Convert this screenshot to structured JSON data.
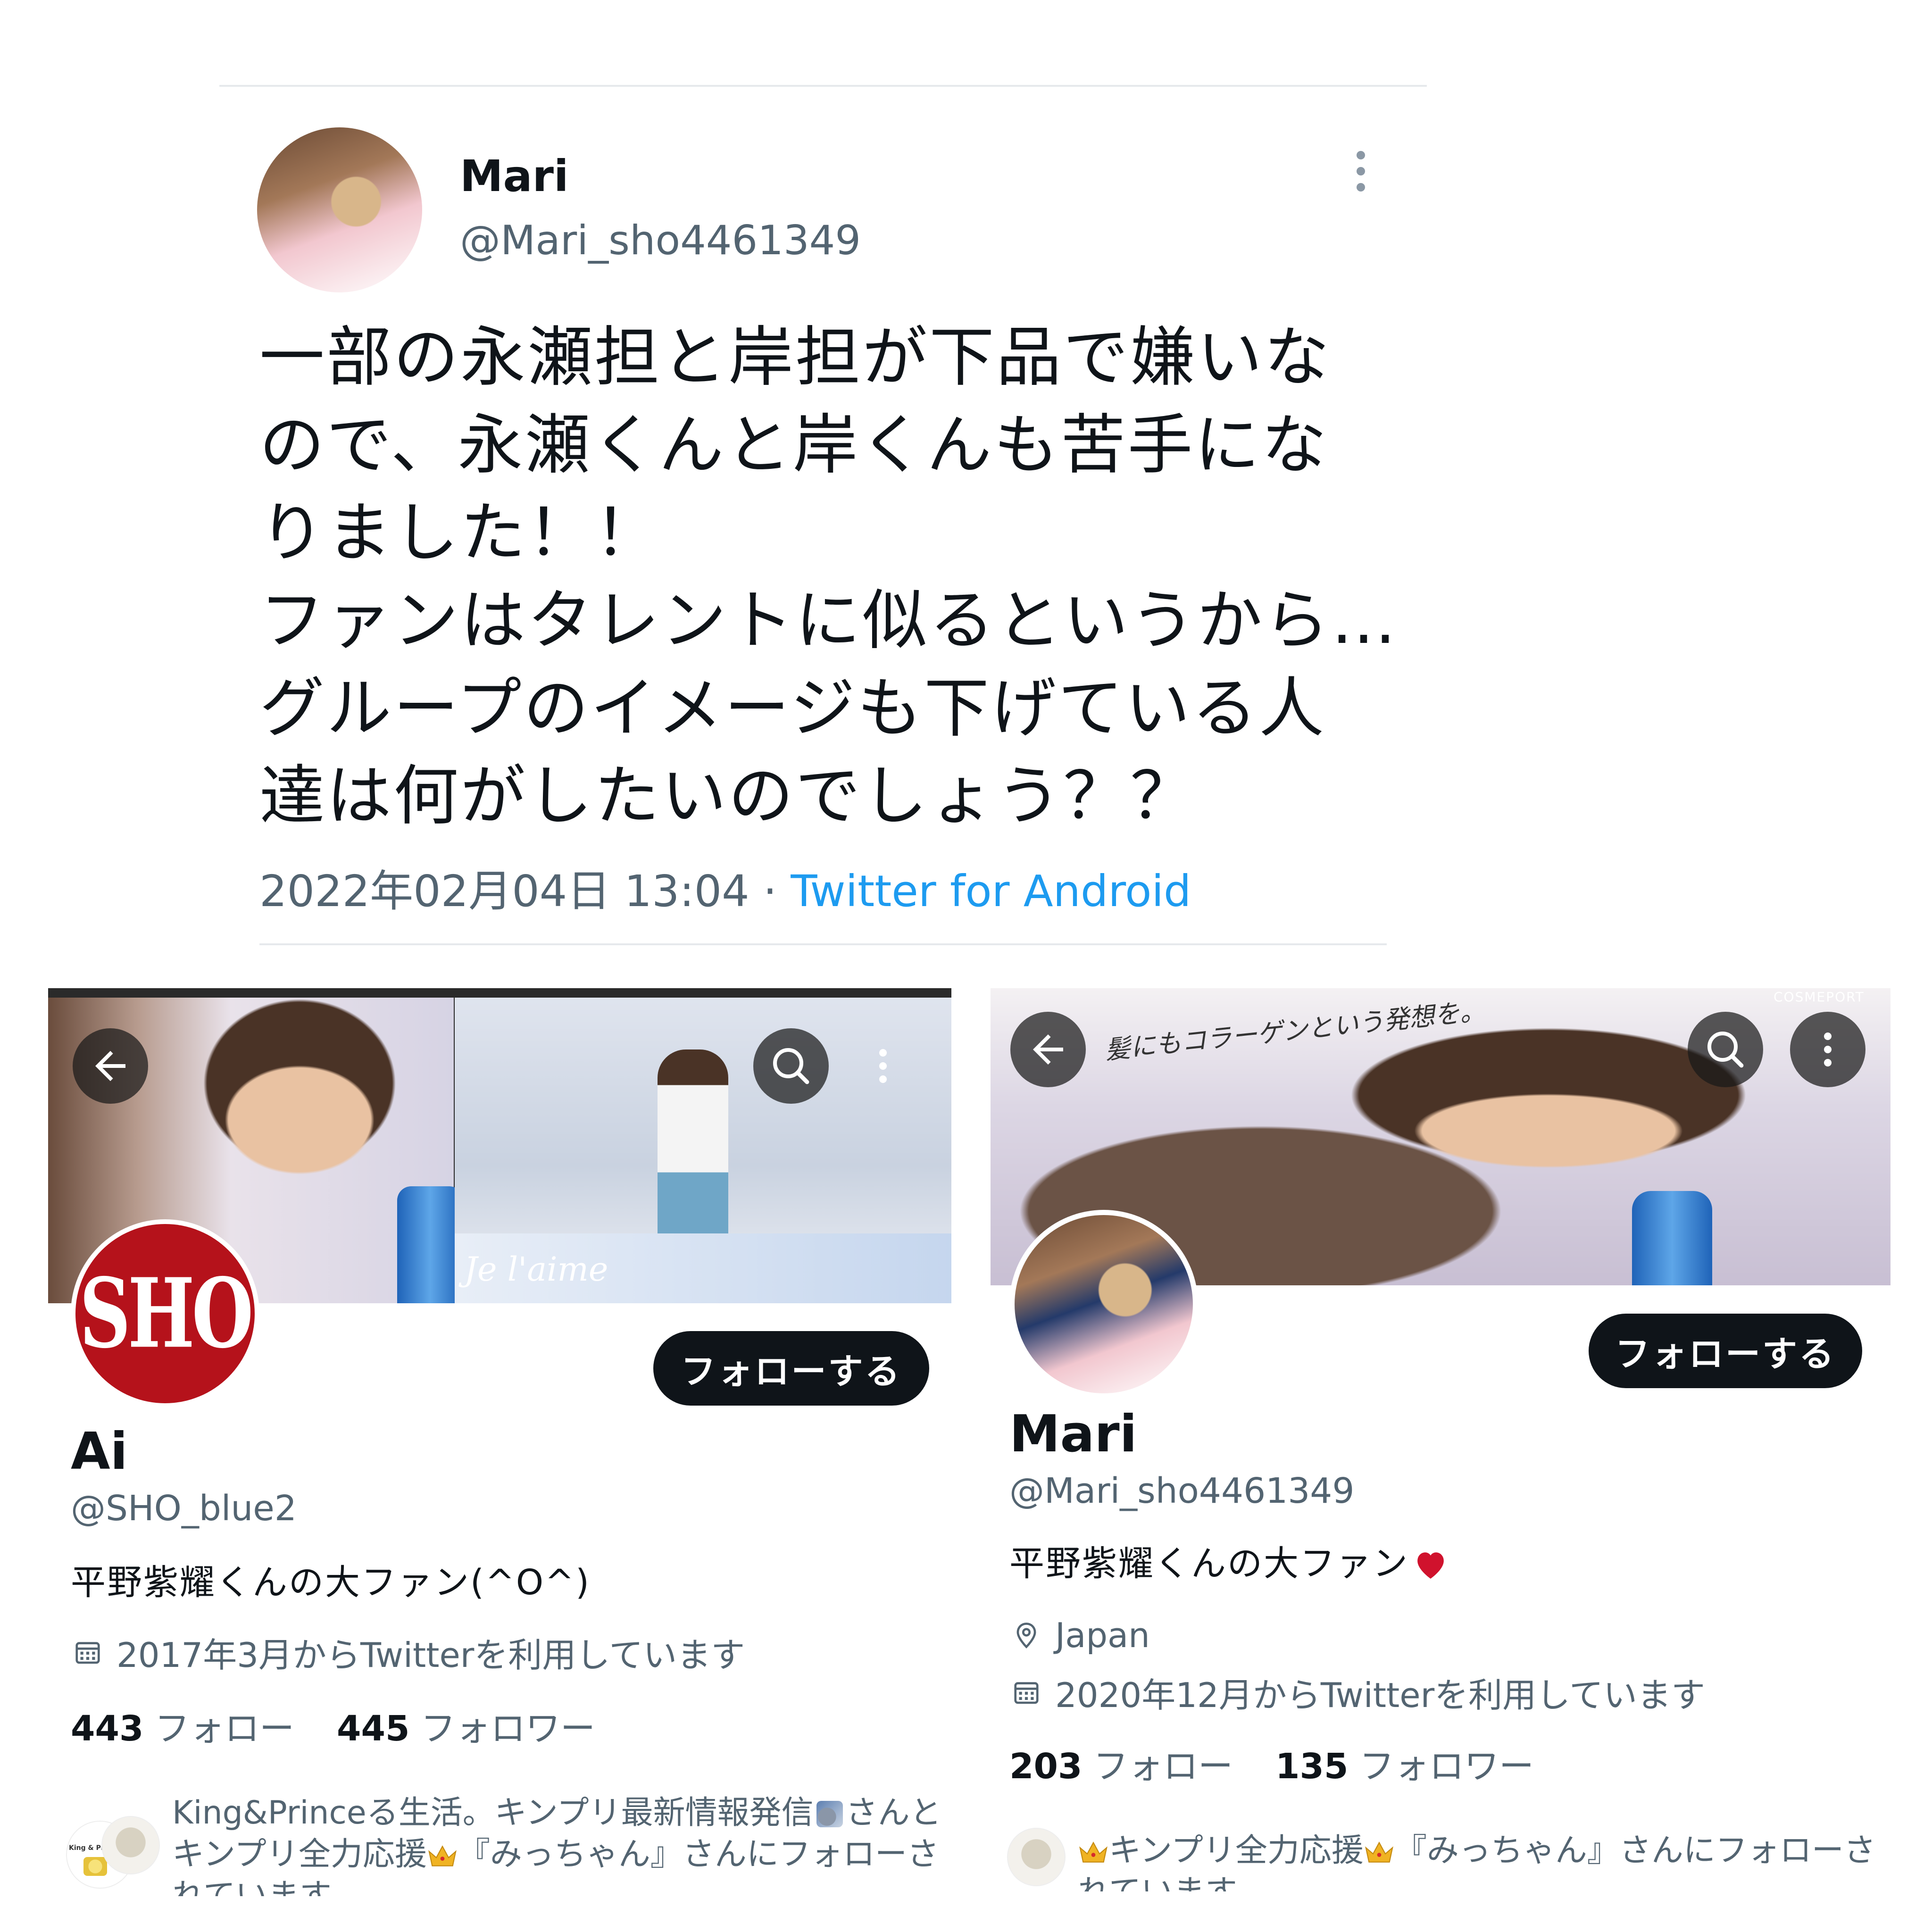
{
  "tweet": {
    "name": "Mari",
    "handle": "@Mari_sho4461349",
    "lines": [
      "一部の永瀬担と岸担が下品で嫌いな",
      "ので、永瀬くんと岸くんも苦手にな",
      "りました！！",
      "ファンはタレントに似るというから…",
      "グループのイメージも下げている人",
      "達は何がしたいのでしょう？？"
    ],
    "timestamp": "2022年02月04日 13:04",
    "separator": " · ",
    "source": "Twitter for Android"
  },
  "profile_ai": {
    "banner_text": "Je l'aime",
    "avatar_text": "SHO",
    "follow_label": "フォローする",
    "name": "Ai",
    "handle": "@SHO_blue2",
    "bio": "平野紫耀くんの大ファン(^O^)",
    "joined": "2017年3月からTwitterを利用しています",
    "following_count": "443",
    "following_label": "フォロー",
    "followers_count": "445",
    "followers_label": "フォロワー",
    "followed_by_part1": "King&Princeる生活。キンプリ最新情報発信",
    "followed_by_part2": "さんと",
    "followed_by_line2a": "キンプリ全力応援",
    "followed_by_line2b": "『みっちゃん』さんにフォローさ",
    "followed_by_line3": "れています",
    "avatar_caption": "King & Prince"
  },
  "profile_mari": {
    "banner_text": "髪にもコラーゲンという発想を。",
    "banner_logo": "COSMEPORT",
    "follow_label": "フォローする",
    "name": "Mari",
    "handle": "@Mari_sho4461349",
    "bio": "平野紫耀くんの大ファン",
    "location": "Japan",
    "joined": "2020年12月からTwitterを利用しています",
    "following_count": "203",
    "following_label": "フォロー",
    "followers_count": "135",
    "followers_label": "フォロワー",
    "followed_by_line1a": "キンプリ全力応援",
    "followed_by_line1b": "『みっちゃん』さんにフォローさ",
    "followed_by_line2": "れています"
  },
  "icons": [
    "back-arrow-icon",
    "search-icon",
    "more-vertical-icon",
    "calendar-icon",
    "location-pin-icon",
    "heart-icon",
    "crown-icon",
    "satellite-icon"
  ],
  "colors": {
    "link": "#1d9bf0",
    "secondary": "#536471",
    "button": "#0f1419",
    "sho_red": "#b5121b",
    "heart": "#d0122d"
  }
}
